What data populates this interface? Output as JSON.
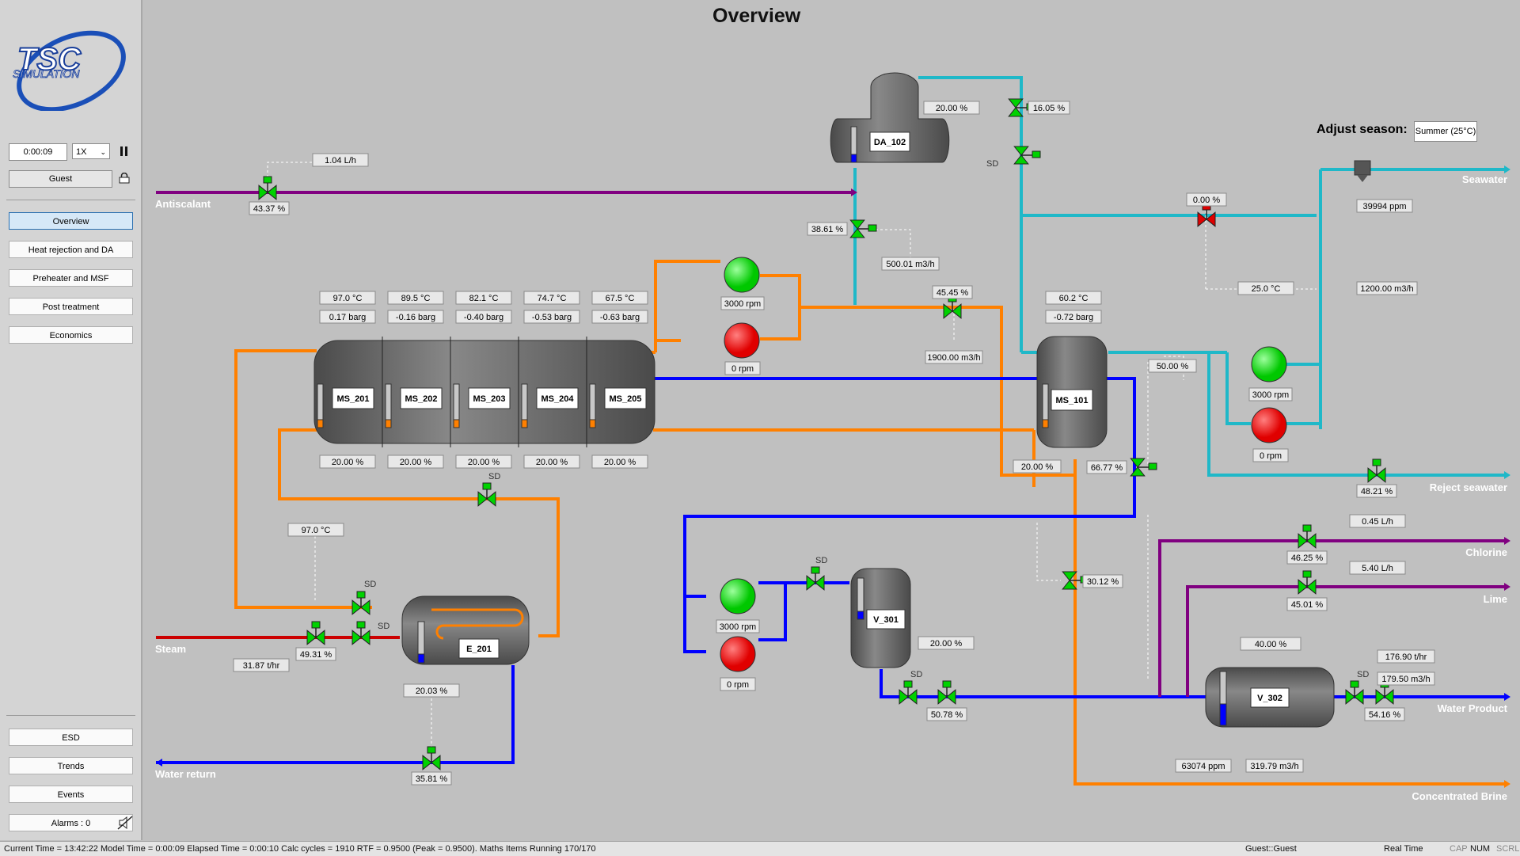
{
  "app": {
    "title": "Overview",
    "logo_text": "TSC",
    "logo_sub": "SIMULATION"
  },
  "sidebar": {
    "sim_time": "0:00:09",
    "speed": "1X",
    "user": "Guest",
    "nav": [
      {
        "label": "Overview"
      },
      {
        "label": "Heat rejection and DA"
      },
      {
        "label": "Preheater and MSF"
      },
      {
        "label": "Post treatment"
      },
      {
        "label": "Economics"
      }
    ],
    "bottom": [
      {
        "label": "ESD"
      },
      {
        "label": "Trends"
      },
      {
        "label": "Events"
      },
      {
        "label": "Alarms : 0"
      }
    ]
  },
  "season": {
    "label": "Adjust season:",
    "value": "Summer (25°C)"
  },
  "streams": {
    "antiscalant": "Antiscalant",
    "steam": "Steam",
    "water_return": "Water return",
    "seawater": "Seawater",
    "reject_seawater": "Reject seawater",
    "chlorine": "Chlorine",
    "lime": "Lime",
    "water_product": "Water Product",
    "concentrated_brine": "Concentrated Brine"
  },
  "vessels": {
    "ms201": "MS_201",
    "ms202": "MS_202",
    "ms203": "MS_203",
    "ms204": "MS_204",
    "ms205": "MS_205",
    "ms101": "MS_101",
    "da102": "DA_102",
    "e201": "E_201",
    "v301": "V_301",
    "v302": "V_302"
  },
  "readouts": {
    "antiscalant_flow": "1.04 L/h",
    "antiscalant_valve": "43.37 %",
    "da_level": "20.00 %",
    "da_inlet_valve": "16.05 %",
    "da_sd": "SD",
    "da_out_valve": "38.61 %",
    "da_out_flow": "500.01 m3/h",
    "t201": "97.0 °C",
    "t202": "89.5 °C",
    "t203": "82.1 °C",
    "t204": "74.7 °C",
    "t205": "67.5 °C",
    "p201": "0.17 barg",
    "p202": "-0.16 barg",
    "p203": "-0.40 barg",
    "p204": "-0.53 barg",
    "p205": "-0.63 barg",
    "l201": "20.00 %",
    "l202": "20.00 %",
    "l203": "20.00 %",
    "l204": "20.00 %",
    "l205": "20.00 %",
    "pump1_top": "3000 rpm",
    "pump1_bot": "0 rpm",
    "recirc_valve": "45.45 %",
    "recirc_flow": "1900.00 m3/h",
    "t101": "60.2 °C",
    "p101": "-0.72 barg",
    "l101": "20.00 %",
    "ms101_valve": "50.00 %",
    "ms101_out_valve": "66.77 %",
    "sw_valve": "0.00 %",
    "sw_salinity": "39994 ppm",
    "sw_temp": "25.0 °C",
    "sw_flow": "1200.00 m3/h",
    "sw_pump_top": "3000 rpm",
    "sw_pump_bot": "0 rpm",
    "reject_valve": "48.21 %",
    "brine_temp": "97.0 °C",
    "sd_label": "SD",
    "steam_flow": "31.87 t/hr",
    "steam_valve": "49.31 %",
    "e201_level": "20.03 %",
    "water_return_valve": "35.81 %",
    "dist_pump_top": "3000 rpm",
    "dist_pump_bot": "0 rpm",
    "v301_level": "20.00 %",
    "v301_valve": "50.78 %",
    "brine_valve": "30.12 %",
    "chlorine_flow": "0.45 L/h",
    "chlorine_valve": "46.25 %",
    "lime_flow": "5.40 L/h",
    "lime_valve": "45.01 %",
    "v302_level": "40.00 %",
    "product_temp": "176.90 t/hr",
    "product_flow": "179.50 m3/h",
    "product_valve": "54.16 %",
    "brine_ppm": "63074 ppm",
    "brine_flow": "319.79 m3/h"
  },
  "colors": {
    "orange": "#ff8000",
    "blue": "#0000ff",
    "teal": "#1fb8c8",
    "purple": "#800080",
    "red": "#cc0000",
    "green": "#00d200",
    "pump_red": "#ff0000"
  },
  "status_bar": {
    "left": "Current Time = 13:42:22 Model Time = 0:00:09 Elapsed Time = 0:00:10 Calc cycles = 1910 RTF = 0.9500 (Peak = 0.9500).  Maths Items Running 170/170",
    "user": "Guest::Guest",
    "mode": "Real Time",
    "cap": "CAP",
    "num": "NUM",
    "scrl": "SCRL"
  }
}
